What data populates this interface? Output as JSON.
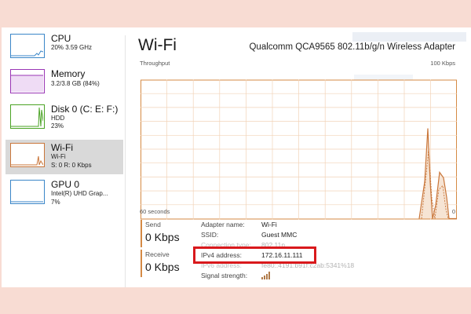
{
  "sidebar": {
    "items": [
      {
        "title": "CPU",
        "line1": "20%  3.59 GHz",
        "line2": "",
        "color": "#3a86c8"
      },
      {
        "title": "Memory",
        "line1": "3.2/3.8 GB (84%)",
        "line2": "",
        "color": "#9a36b5"
      },
      {
        "title": "Disk 0 (C: E: F:)",
        "line1": "HDD",
        "line2": "23%",
        "color": "#4aa324"
      },
      {
        "title": "Wi-Fi",
        "line1": "Wi-Fi",
        "line2": "S: 0  R: 0 Kbps",
        "color": "#c9763a"
      },
      {
        "title": "GPU 0",
        "line1": "Intel(R) UHD Grap...",
        "line2": "7%",
        "color": "#3a86c8"
      }
    ],
    "selected_index": 3
  },
  "header": {
    "title": "Wi-Fi",
    "adapter": "Qualcomm QCA9565 802.11b/g/n Wireless Adapter"
  },
  "graph": {
    "label": "Throughput",
    "max_label": "100 Kbps",
    "time_label": "60 seconds",
    "zero_label": "0",
    "accent_color": "#d58a44"
  },
  "send": {
    "label": "Send",
    "value": "0 Kbps"
  },
  "receive": {
    "label": "Receive",
    "value": "0 Kbps"
  },
  "details": [
    {
      "key": "Adapter name:",
      "value": "Wi-Fi"
    },
    {
      "key": "SSID:",
      "value": "Guest MMC"
    },
    {
      "key": "Connection type:",
      "value": "802.11n"
    },
    {
      "key": "IPv4 address:",
      "value": "172.16.11.111"
    },
    {
      "key": "IPv6 address:",
      "value": "fe80::4191:b91f:c2ab:5341%18"
    },
    {
      "key": "Signal strength:",
      "value": ""
    }
  ],
  "signal_bars": 4,
  "highlight_color": "#d9191c"
}
